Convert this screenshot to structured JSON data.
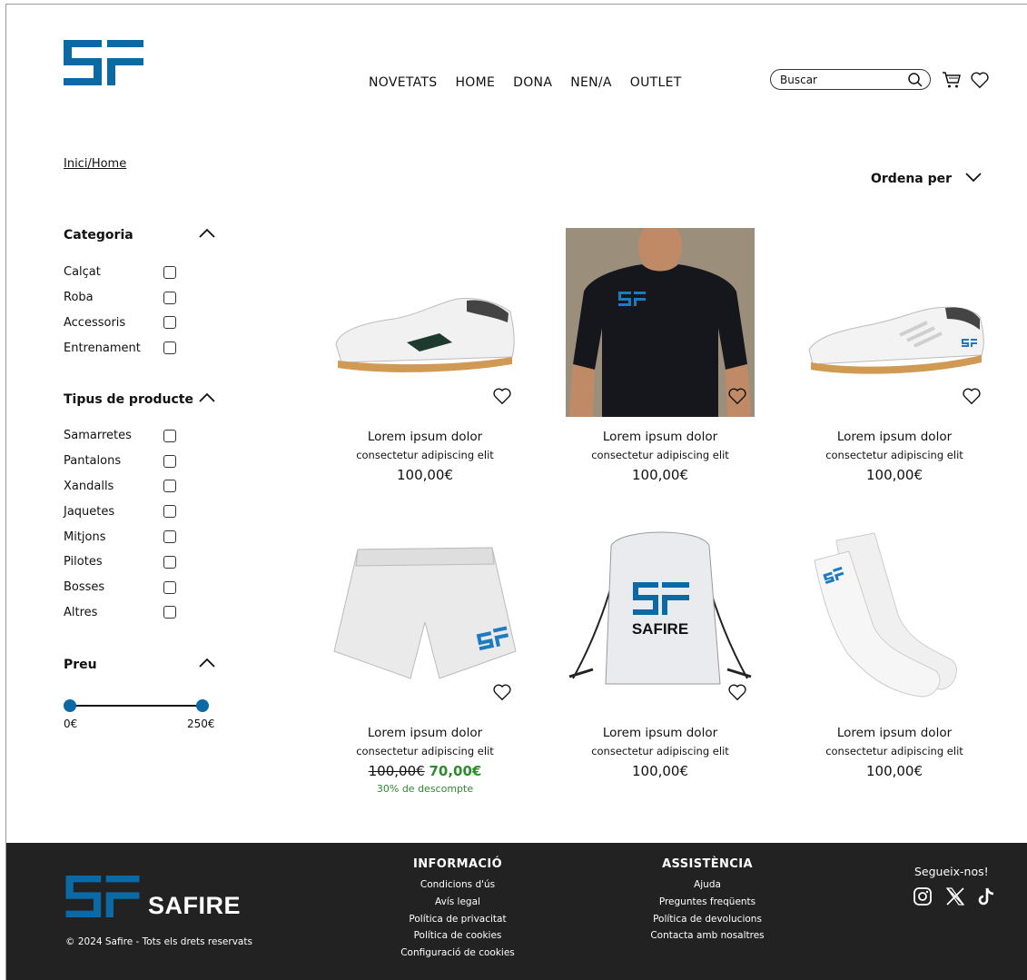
{
  "brand": {
    "name": "SAFIRE",
    "accent": "#0b6aa6"
  },
  "nav": [
    "NOVETATS",
    "HOME",
    "DONA",
    "NEN/A",
    "OUTLET"
  ],
  "search": {
    "placeholder": "Buscar"
  },
  "breadcrumb": "Inici/Home",
  "sort_label": "Ordena per",
  "filters": {
    "category": {
      "title": "Categoria",
      "items": [
        "Calçat",
        "Roba",
        "Accessoris",
        "Entrenament"
      ]
    },
    "product_type": {
      "title": "Tipus de producte",
      "items": [
        "Samarretes",
        "Pantalons",
        "Xandalls",
        "Jaquetes",
        "Mitjons",
        "Pilotes",
        "Bosses",
        "Altres"
      ]
    },
    "price": {
      "title": "Preu",
      "min": "0€",
      "max": "250€"
    }
  },
  "products": [
    {
      "name": "Lorem ipsum dolor",
      "desc": "consectetur adipiscing elit",
      "price": "100,00€",
      "image": "white-sneaker-black-stripe"
    },
    {
      "name": "Lorem ipsum dolor",
      "desc": "consectetur adipiscing elit",
      "price": "100,00€",
      "image": "black-tshirt-model"
    },
    {
      "name": "Lorem ipsum dolor",
      "desc": "consectetur adipiscing elit",
      "price": "100,00€",
      "image": "white-sneaker-logo"
    },
    {
      "name": "Lorem ipsum dolor",
      "desc": "consectetur adipiscing elit",
      "old_price": "100,00€",
      "price": "70,00€",
      "discount": "30% de descompte",
      "image": "white-shorts"
    },
    {
      "name": "Lorem ipsum dolor",
      "desc": "consectetur adipiscing elit",
      "price": "100,00€",
      "image": "drawstring-bag",
      "bag_text": "SAFIRE"
    },
    {
      "name": "Lorem ipsum dolor",
      "desc": "consectetur adipiscing elit",
      "price": "100,00€",
      "image": "white-socks"
    }
  ],
  "footer": {
    "info": {
      "title": "INFORMACIÓ",
      "links": [
        "Condicions d'ús",
        "Avís legal",
        "Política de privacitat",
        "Política de cookies",
        "Configuració de cookies"
      ]
    },
    "assist": {
      "title": "ASSISTÈNCIA",
      "links": [
        "Ajuda",
        "Preguntes freqüents",
        "Política de devolucions",
        "Contacta amb nosaltres"
      ]
    },
    "copyright": "© 2024 Safire - Tots els drets reservats",
    "follow": "Segueix-nos!",
    "social_icons": [
      "instagram-icon",
      "x-icon",
      "tiktok-icon"
    ]
  }
}
